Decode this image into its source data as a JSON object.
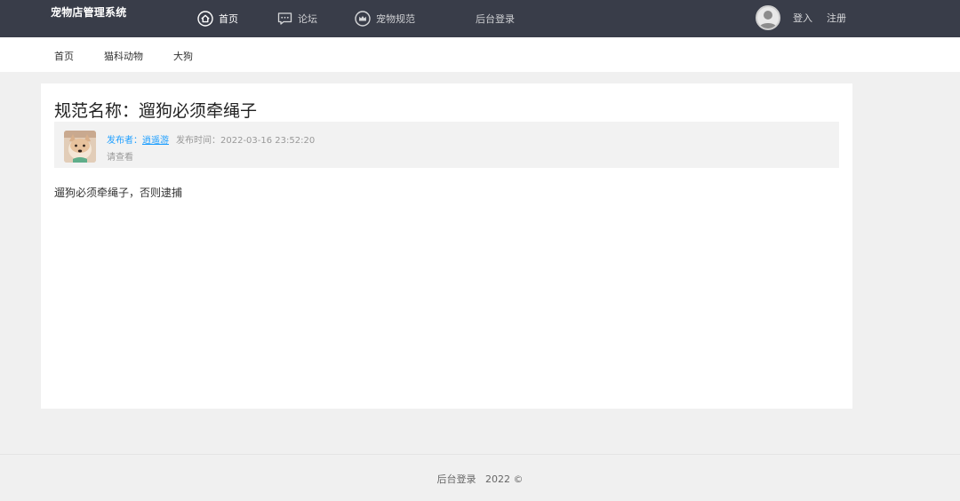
{
  "header": {
    "logo": "宠物店管理系统",
    "nav": [
      {
        "label": "首页",
        "icon": "home-icon"
      },
      {
        "label": "论坛",
        "icon": "chat-icon"
      },
      {
        "label": "宠物规范",
        "icon": "crown-icon"
      },
      {
        "label": "后台登录"
      }
    ],
    "login_label": "登入",
    "register_label": "注册"
  },
  "subnav": {
    "items": [
      "首页",
      "猫科动物",
      "大狗"
    ]
  },
  "article": {
    "title": "规范名称：遛狗必须牵绳子",
    "author_label": "发布者：",
    "author": "逍遥游",
    "time_label": "发布时间：",
    "time": "2022-03-16 23:52:20",
    "summary": "请查看",
    "body": "遛狗必须牵绳子，否则逮捕"
  },
  "footer": {
    "text": "后台登录   2022 ©"
  },
  "colors": {
    "header_bg": "#393d49",
    "link_blue": "#1e9fff",
    "page_bg": "#f0f0f0"
  }
}
